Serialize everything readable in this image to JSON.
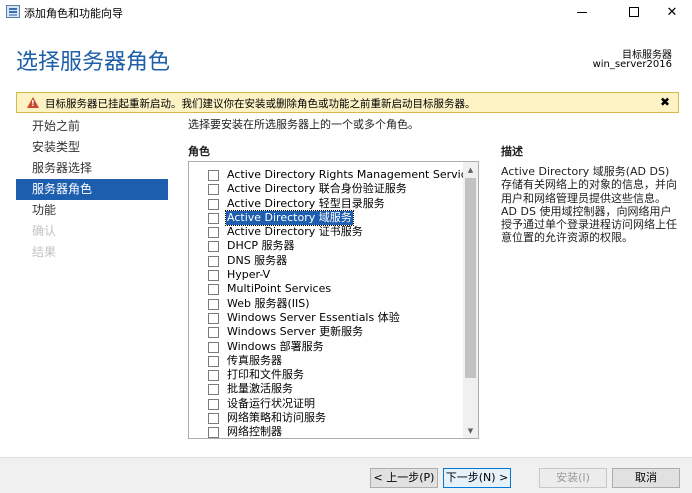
{
  "window": {
    "title": "添加角色和功能向导",
    "min_glyph": "",
    "close_glyph": "✕"
  },
  "header": {
    "page_title": "选择服务器角色",
    "target_label": "目标服务器",
    "target_name": "win_server2016"
  },
  "warning": {
    "text": "目标服务器已挂起重新启动。我们建议你在安装或删除角色或功能之前重新启动目标服务器。",
    "close_glyph": "✖"
  },
  "nav": {
    "items": [
      {
        "label": "开始之前",
        "state": "normal"
      },
      {
        "label": "安装类型",
        "state": "normal"
      },
      {
        "label": "服务器选择",
        "state": "normal"
      },
      {
        "label": "服务器角色",
        "state": "active"
      },
      {
        "label": "功能",
        "state": "normal"
      },
      {
        "label": "确认",
        "state": "disabled"
      },
      {
        "label": "结果",
        "state": "disabled"
      }
    ]
  },
  "main": {
    "instruction": "选择要安装在所选服务器上的一个或多个角色。",
    "roles_label": "角色",
    "description_label": "描述",
    "description_text": "Active Directory 域服务(AD DS)存储有关网络上的对象的信息，并向用户和网络管理员提供这些信息。AD DS 使用域控制器，向网络用户授予通过单个登录进程访问网络上任意位置的允许资源的权限。",
    "roles": [
      {
        "label": "Active Directory Rights Management Services",
        "checked": false,
        "selected": false
      },
      {
        "label": "Active Directory 联合身份验证服务",
        "checked": false,
        "selected": false
      },
      {
        "label": "Active Directory 轻型目录服务",
        "checked": false,
        "selected": false
      },
      {
        "label": "Active Directory 域服务",
        "checked": false,
        "selected": true
      },
      {
        "label": "Active Directory 证书服务",
        "checked": false,
        "selected": false
      },
      {
        "label": "DHCP 服务器",
        "checked": false,
        "selected": false
      },
      {
        "label": "DNS 服务器",
        "checked": false,
        "selected": false
      },
      {
        "label": "Hyper-V",
        "checked": false,
        "selected": false
      },
      {
        "label": "MultiPoint Services",
        "checked": false,
        "selected": false
      },
      {
        "label": "Web 服务器(IIS)",
        "checked": false,
        "selected": false
      },
      {
        "label": "Windows Server Essentials 体验",
        "checked": false,
        "selected": false
      },
      {
        "label": "Windows Server 更新服务",
        "checked": false,
        "selected": false
      },
      {
        "label": "Windows 部署服务",
        "checked": false,
        "selected": false
      },
      {
        "label": "传真服务器",
        "checked": false,
        "selected": false
      },
      {
        "label": "打印和文件服务",
        "checked": false,
        "selected": false
      },
      {
        "label": "批量激活服务",
        "checked": false,
        "selected": false
      },
      {
        "label": "设备运行状况证明",
        "checked": false,
        "selected": false
      },
      {
        "label": "网络策略和访问服务",
        "checked": false,
        "selected": false
      },
      {
        "label": "网络控制器",
        "checked": false,
        "selected": false
      }
    ]
  },
  "footer": {
    "prev_label": "< 上一步(P)",
    "next_label": "下一步(N) >",
    "install_label": "安装(I)",
    "cancel_label": "取消"
  }
}
